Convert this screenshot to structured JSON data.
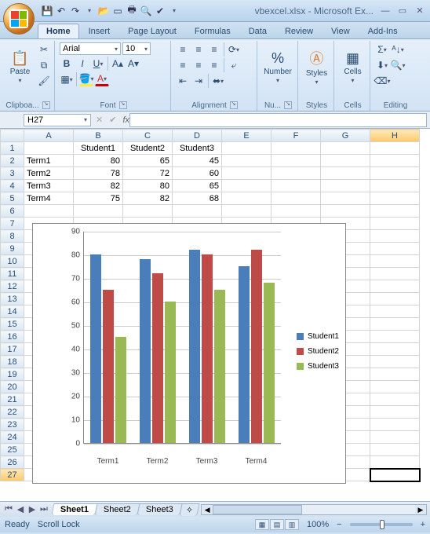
{
  "title_doc": "vbexcel.xlsx",
  "title_app": "Microsoft Ex...",
  "tabs": {
    "home": "Home",
    "insert": "Insert",
    "page_layout": "Page Layout",
    "formulas": "Formulas",
    "data": "Data",
    "review": "Review",
    "view": "View",
    "addins": "Add-Ins"
  },
  "ribbon": {
    "clipboard": {
      "label": "Clipboa...",
      "paste": "Paste"
    },
    "font": {
      "label": "Font",
      "name": "Arial",
      "size": "10"
    },
    "alignment": {
      "label": "Alignment"
    },
    "number": {
      "label": "Nu...",
      "btn": "Number"
    },
    "styles": {
      "label": "Styles",
      "btn": "Styles"
    },
    "cells": {
      "label": "Cells",
      "btn": "Cells"
    },
    "editing": {
      "label": "Editing"
    }
  },
  "namebox": "H27",
  "columns": [
    "A",
    "B",
    "C",
    "D",
    "E",
    "F",
    "G",
    "H"
  ],
  "rows": [
    1,
    2,
    3,
    4,
    5,
    6,
    7,
    8,
    9,
    10,
    11,
    12,
    13,
    14,
    15,
    16,
    17,
    18,
    19,
    20,
    21,
    22,
    23,
    24,
    25,
    26,
    27
  ],
  "headers": {
    "b": "Student1",
    "c": "Student2",
    "d": "Student3"
  },
  "data_rows": [
    {
      "a": "Term1",
      "b": "80",
      "c": "65",
      "d": "45"
    },
    {
      "a": "Term2",
      "b": "78",
      "c": "72",
      "d": "60"
    },
    {
      "a": "Term3",
      "b": "82",
      "c": "80",
      "d": "65"
    },
    {
      "a": "Term4",
      "b": "75",
      "c": "82",
      "d": "68"
    }
  ],
  "chart_data": {
    "type": "bar",
    "categories": [
      "Term1",
      "Term2",
      "Term3",
      "Term4"
    ],
    "series": [
      {
        "name": "Student1",
        "values": [
          80,
          78,
          82,
          75
        ],
        "color": "#4a7ebb"
      },
      {
        "name": "Student2",
        "values": [
          65,
          72,
          80,
          82
        ],
        "color": "#be4b48"
      },
      {
        "name": "Student3",
        "values": [
          45,
          60,
          65,
          68
        ],
        "color": "#98b954"
      }
    ],
    "ylim": [
      0,
      90
    ],
    "ystep": 10
  },
  "sheets": {
    "s1": "Sheet1",
    "s2": "Sheet2",
    "s3": "Sheet3"
  },
  "status": {
    "ready": "Ready",
    "scroll": "Scroll Lock",
    "zoom": "100%"
  }
}
